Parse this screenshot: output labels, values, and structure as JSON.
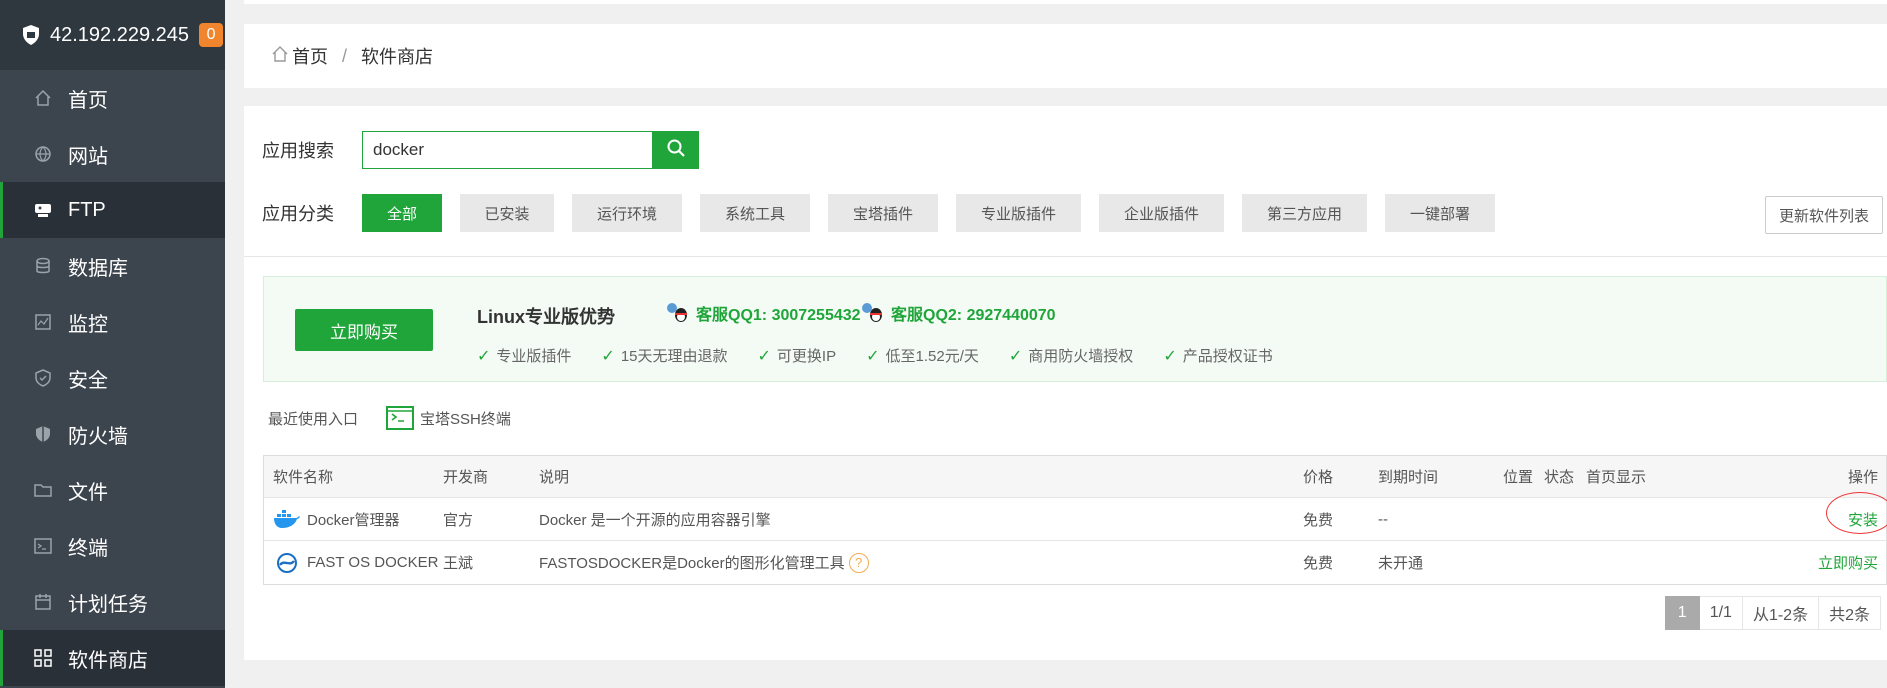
{
  "sidebar": {
    "ip": "42.192.229.245",
    "badge": "0",
    "items": [
      {
        "label": "首页",
        "icon": "home-icon"
      },
      {
        "label": "网站",
        "icon": "globe-icon"
      },
      {
        "label": "FTP",
        "icon": "ftp-icon"
      },
      {
        "label": "数据库",
        "icon": "database-icon"
      },
      {
        "label": "监控",
        "icon": "monitor-icon"
      },
      {
        "label": "安全",
        "icon": "shield-check-icon"
      },
      {
        "label": "防火墙",
        "icon": "firewall-icon"
      },
      {
        "label": "文件",
        "icon": "folder-icon"
      },
      {
        "label": "终端",
        "icon": "terminal-icon"
      },
      {
        "label": "计划任务",
        "icon": "calendar-icon"
      },
      {
        "label": "软件商店",
        "icon": "grid-icon"
      }
    ]
  },
  "breadcrumb": {
    "home": "首页",
    "separator": "/",
    "current": "软件商店"
  },
  "search": {
    "label": "应用搜索",
    "value": "docker"
  },
  "categories": {
    "label": "应用分类",
    "items": [
      "全部",
      "已安装",
      "运行环境",
      "系统工具",
      "宝塔插件",
      "专业版插件",
      "企业版插件",
      "第三方应用",
      "一键部署"
    ]
  },
  "refresh_label": "更新软件列表",
  "promo": {
    "buy_label": "立即购买",
    "title": "Linux专业版优势",
    "qq1": "客服QQ1: 3007255432",
    "qq2": "客服QQ2: 2927440070",
    "features": [
      "专业版插件",
      "15天无理由退款",
      "可更换IP",
      "低至1.52元/天",
      "商用防火墙授权",
      "产品授权证书"
    ]
  },
  "recent": {
    "label": "最近使用入口",
    "ssh_label": "宝塔SSH终端"
  },
  "table": {
    "headers": {
      "name": "软件名称",
      "dev": "开发商",
      "desc": "说明",
      "price": "价格",
      "expire": "到期时间",
      "position": "位置",
      "status": "状态",
      "home_show": "首页显示",
      "op": "操作"
    },
    "rows": [
      {
        "name": "Docker管理器",
        "dev": "官方",
        "desc": "Docker 是一个开源的应用容器引擎",
        "price": "免费",
        "expire": "--",
        "op": "安装"
      },
      {
        "name": "FAST OS DOCKER",
        "dev": "王斌",
        "desc": "FASTOSDOCKER是Docker的图形化管理工具",
        "price": "免费",
        "expire": "未开通",
        "op": "立即购买"
      }
    ]
  },
  "pager": {
    "current": "1",
    "pages": "1/1",
    "range": "从1-2条",
    "total": "共2条"
  },
  "colors": {
    "accent": "#20a53a",
    "sidebar": "#3c444d",
    "badge": "#f0852d"
  }
}
